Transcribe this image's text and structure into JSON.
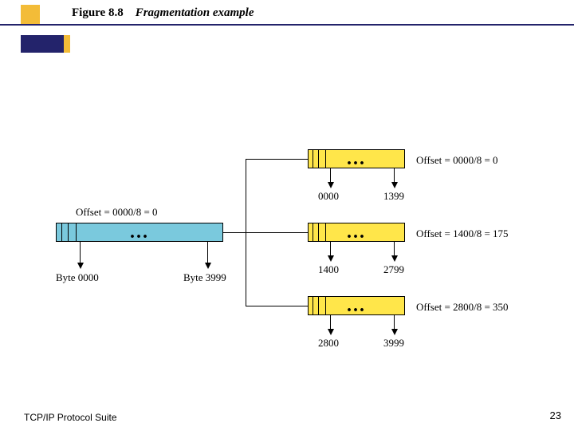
{
  "header": {
    "figure_number": "Figure 8.8",
    "figure_title": "Fragmentation example"
  },
  "footer": {
    "left": "TCP/IP Protocol Suite",
    "page": "23"
  },
  "diagram": {
    "original": {
      "offset_label": "Offset = 0000/8 = 0",
      "start_byte_label": "Byte 0000",
      "end_byte_label": "Byte 3999",
      "dots": "..."
    },
    "fragments": [
      {
        "offset_label": "Offset = 0000/8 = 0",
        "start_byte": "0000",
        "end_byte": "1399",
        "dots": "..."
      },
      {
        "offset_label": "Offset = 1400/8 = 175",
        "start_byte": "1400",
        "end_byte": "2799",
        "dots": "..."
      },
      {
        "offset_label": "Offset = 2800/8 = 350",
        "start_byte": "2800",
        "end_byte": "3999",
        "dots": "..."
      }
    ]
  }
}
